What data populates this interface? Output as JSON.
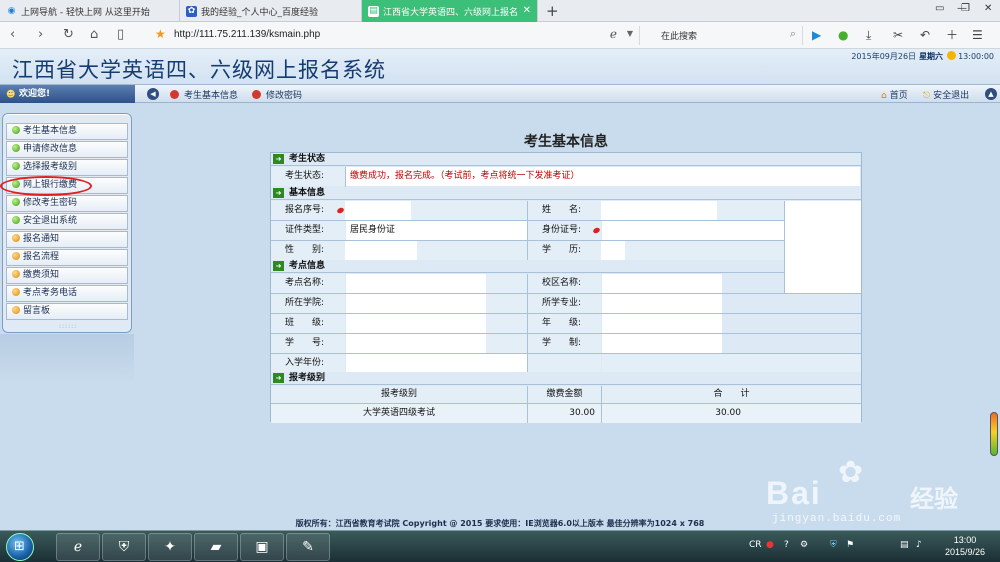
{
  "browser": {
    "tabs": [
      {
        "label": "上网导航 - 轻快上网 从这里开始",
        "icon": "globe-icon",
        "active": false
      },
      {
        "label": "我的经验_个人中心_百度经验",
        "icon": "baidu-paw-icon",
        "active": false
      },
      {
        "label": "江西省大学英语四、六级网上报名系",
        "icon": "page-icon",
        "active": true
      }
    ],
    "new_tab_symbol": "+",
    "address": "http://111.75.211.139/ksmain.php",
    "search_placeholder": "在此搜索"
  },
  "site": {
    "title": "江西省大学英语四、六级网上报名系统",
    "date": "2015年09月26日",
    "weekday": "星期六",
    "time": "13:00:00"
  },
  "menubar": {
    "welcome": "欢迎您!",
    "items": [
      "考生基本信息",
      "修改密码"
    ],
    "home": "首页",
    "logout": "安全退出"
  },
  "sidemenu": {
    "items": [
      {
        "label": "考生基本信息",
        "color": "green"
      },
      {
        "label": "申请修改信息",
        "color": "green"
      },
      {
        "label": "选择报考级别",
        "color": "green"
      },
      {
        "label": "网上银行缴费",
        "color": "green"
      },
      {
        "label": "修改考生密码",
        "color": "green"
      },
      {
        "label": "安全退出系统",
        "color": "green"
      },
      {
        "label": "报名通知",
        "color": "orange"
      },
      {
        "label": "报名流程",
        "color": "orange"
      },
      {
        "label": "缴费须知",
        "color": "orange"
      },
      {
        "label": "考点考务电话",
        "color": "orange"
      },
      {
        "label": "留言板",
        "color": "orange"
      }
    ]
  },
  "main": {
    "title": "考生基本信息",
    "sections": {
      "status": "考生状态",
      "basic": "基本信息",
      "exam_site": "考点信息",
      "level": "报考级别"
    },
    "status_label": "考生状态:",
    "status_value": "缴费成功，报名完成。（考试前，考点将统一下发准考证）",
    "labels": {
      "reg_no": "报名序号:",
      "name": "姓　　名:",
      "id_type": "证件类型:",
      "id_no": "身份证号:",
      "gender": "性　　别:",
      "education": "学　　历:",
      "site_name": "考点名称:",
      "campus": "校区名称:",
      "school": "所在学院:",
      "major": "所学专业:",
      "class": "班　　级:",
      "grade": "年　　级:",
      "student_no": "学　　号:",
      "duration": "学　　制:",
      "enroll_year": "入学年份:"
    },
    "id_type_value": "居民身份证",
    "fee_table": {
      "headers": [
        "报考级别",
        "缴费金额",
        "合　　计"
      ],
      "rows": [
        {
          "level": "大学英语四级考试",
          "amount": "30.00",
          "total": "30.00"
        }
      ]
    }
  },
  "footer": "版权所有：江西省教育考试院 Copyright @ 2015 要求使用：IE浏览器6.0以上版本 最佳分辨率为1024 x 768",
  "watermark": {
    "brand": "Bai",
    "brand2": "经验",
    "site": "jingyan.baidu.com"
  },
  "taskbar": {
    "time": "13:00",
    "date": "2015/9/26",
    "lang": "CR"
  }
}
